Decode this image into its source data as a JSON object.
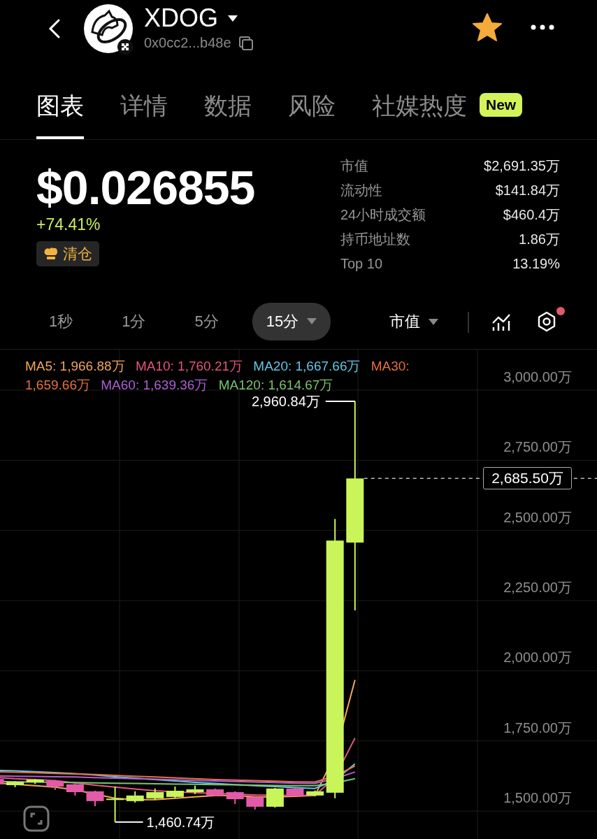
{
  "header": {
    "title": "XDOG",
    "address": "0x0cc2...b48e",
    "favorite": true
  },
  "tabs": [
    {
      "label": "图表",
      "selected": true
    },
    {
      "label": "详情",
      "selected": false
    },
    {
      "label": "数据",
      "selected": false
    },
    {
      "label": "风险",
      "selected": false
    },
    {
      "label": "社媒热度",
      "selected": false,
      "badge": "New"
    }
  ],
  "price": {
    "value": "$0.026855",
    "change": "+74.41%",
    "tag": "清仓"
  },
  "stats": [
    {
      "label": "市值",
      "value": "$2,691.35万"
    },
    {
      "label": "流动性",
      "value": "$141.84万"
    },
    {
      "label": "24小时成交额",
      "value": "$460.4万"
    },
    {
      "label": "持币地址数",
      "value": "1.86万"
    },
    {
      "label": "Top 10",
      "value": "13.19%"
    }
  ],
  "intervals": [
    {
      "label": "1秒",
      "selected": false
    },
    {
      "label": "1分",
      "selected": false
    },
    {
      "label": "5分",
      "selected": false
    },
    {
      "label": "15分",
      "selected": true
    }
  ],
  "metric": {
    "label": "市值"
  },
  "settings": {
    "notification": true
  },
  "chart": {
    "legend": [
      {
        "label": "MA5: 1,966.88万",
        "color": "#f2a65a"
      },
      {
        "label": "MA10: 1,760.21万",
        "color": "#e2577c"
      },
      {
        "label": "MA20: 1,667.66万",
        "color": "#62c6e4"
      },
      {
        "label": "MA30: 1,659.66万",
        "color": "#e8713c"
      },
      {
        "label": "MA60: 1,639.36万",
        "color": "#b05ed6"
      },
      {
        "label": "MA120: 1,614.67万",
        "color": "#7cc46e"
      }
    ],
    "axis_labels": [
      "3,000.00万",
      "2,750.00万",
      "2,500.00万",
      "2,250.00万",
      "2,000.00万",
      "1,750.00万",
      "1,500.00万"
    ],
    "high_label": "2,960.84万",
    "low_label": "1,460.74万",
    "last_price": "2,685.50万"
  }
}
